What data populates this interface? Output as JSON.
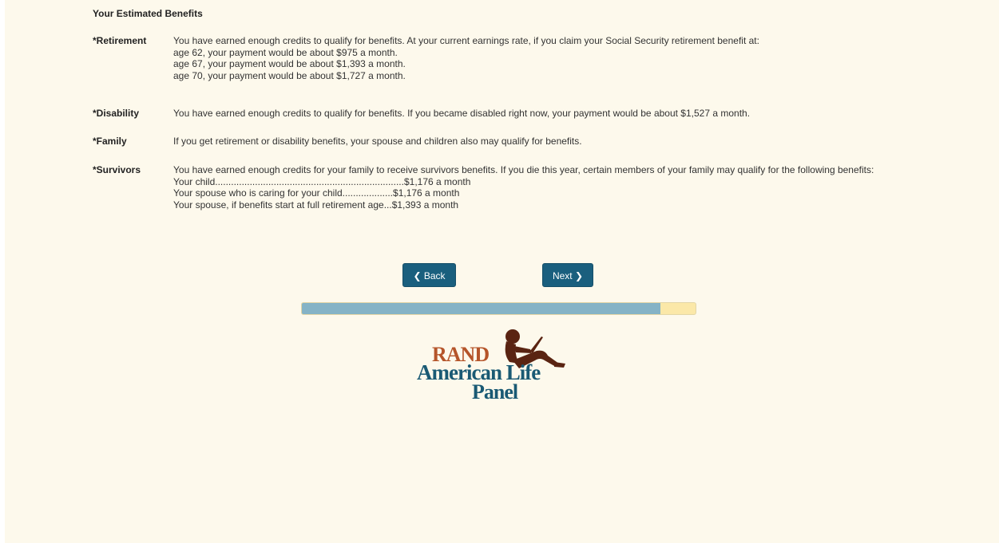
{
  "heading": "Your Estimated Benefits",
  "sections": [
    {
      "label": "*Retirement",
      "lines": [
        "You have earned enough credits to qualify for benefits. At your current earnings rate, if you claim your Social Security retirement benefit at:",
        "age 62, your payment would be about $975 a month.",
        "age 67, your payment would be about $1,393 a month.",
        "age 70, your payment would be about $1,727 a month."
      ]
    },
    {
      "label": "*Disability",
      "lines": [
        "You have earned enough credits to qualify for benefits. If you became disabled right now, your payment would be about $1,527 a month."
      ]
    },
    {
      "label": "*Family",
      "lines": [
        "If you get retirement or disability benefits, your spouse and children also may qualify for benefits."
      ]
    },
    {
      "label": "*Survivors",
      "lines": [
        "You have earned enough credits for your family to receive survivors benefits. If you die this year, certain members of your family may qualify for the following benefits:",
        "Your child.......................................................................$1,176 a month",
        "Your spouse who is caring for your child...................$1,176 a month",
        "Your spouse, if benefits start at full retirement age...$1,393 a month"
      ]
    }
  ],
  "nav": {
    "back_label": "Back",
    "next_label": "Next",
    "back_icon": "chevron-left-icon",
    "next_icon": "chevron-right-icon"
  },
  "progress": {
    "fraction": 0.91
  },
  "logo": {
    "line1": "RAND",
    "line2": "American Life",
    "line3": "Panel"
  },
  "colors": {
    "background": "#fdf9ec",
    "button": "#1a5f7e",
    "progress_fill": "#85b3c6",
    "progress_track": "#fbe8a8",
    "logo_rand": "#b5552a",
    "logo_text": "#1a5a74"
  }
}
